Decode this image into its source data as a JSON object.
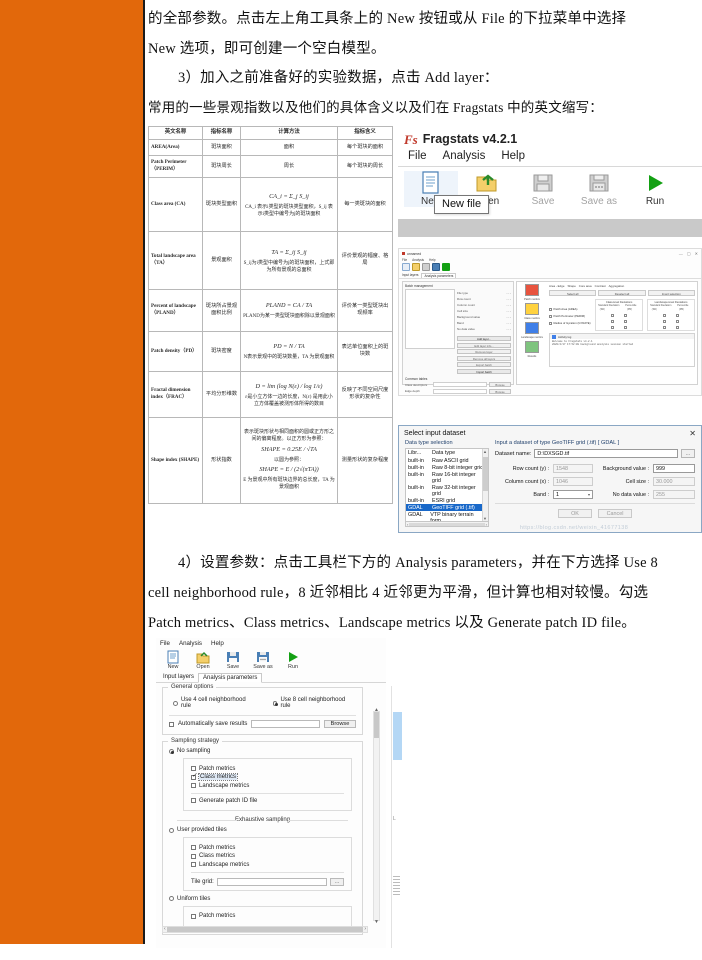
{
  "document": {
    "paragraph_1": "的全部参数。点击左上角工具条上的 New 按钮或从 File 的下拉菜单中选择",
    "paragraph_1b": "New 选项，即可创建一个空白模型。",
    "paragraph_2": "3）加入之前准备好的实验数据，点击 Add layer：",
    "paragraph_3": "常用的一些景观指数以及他们的具体含义以及们在 Fragstats 中的英文缩写：",
    "paragraph_4a": "4）设置参数：点击工具栏下方的 Analysis parameters，并在下方选择 Use 8",
    "paragraph_4b": "cell neighborhood rule，8 近邻相比 4 近邻更为平滑，但计算也相对较慢。勾选",
    "paragraph_4c": "Patch metrics、Class metrics、Landscape metrics 以及 Generate patch ID file。"
  },
  "metric_table": {
    "headers": [
      "英文名称",
      "指标名称",
      "计算方法",
      "指标含义"
    ],
    "rows": [
      {
        "english": "AREA(Area)",
        "chinese": "斑块面积",
        "method_plain": "面积",
        "meaning": "每个斑块的面积"
      },
      {
        "english": "Patch Perimeter（PERIM）",
        "chinese": "斑块周长",
        "method_plain": "周长",
        "meaning": "每个斑块的周长"
      },
      {
        "english": "Class area (CA)",
        "chinese": "斑块类型面积",
        "formula": "CA_i = Σ_j S_ij",
        "method_note": "CA_i 表示i类型的斑块类型面积，S_ij 表示i类型中编号为j的斑块面积",
        "meaning": "每一类斑块的面积"
      },
      {
        "english": "Total landscape area （TA）",
        "chinese": "景观面积",
        "formula": "TA = Σ_ij S_ij",
        "method_note": "S_ij为i类型中编号为j的斑块面积，上式即为所有景观的总面积",
        "meaning": "评价景观的幅度、格局"
      },
      {
        "english": "Percent of landscape（PLAND）",
        "chinese": "斑块所占景观面积比例",
        "formula": "PLAND = CA / TA",
        "method_note": "PLAND为某一类型斑块面积除以景观面积",
        "meaning": "评价某一类型斑块出现频率"
      },
      {
        "english": "Patch density（PD）",
        "chinese": "斑块密度",
        "formula": "PD = N / TA",
        "method_note": "N表示景观中的斑块数量，TA 为景观面积",
        "meaning": "表达单位面积上的斑块数"
      },
      {
        "english": "Fractal dimension index（FRAC）",
        "chinese": "平均分形维数",
        "formula": "D = lim (log N(ε) / log 1/ε)",
        "method_note": "ε是小立方体一边的长度，N(ε) 是用此小立方体覆盖被测形体所得的数目",
        "meaning": "反映了不同空间尺度形状的复杂性"
      },
      {
        "english": "Shape index (SHAPE)",
        "chinese": "形状指数",
        "formula_intro": "表示斑块形状与相同面积的圆或正方形之间的偏离程度。以正方形为参照：",
        "formula_1": "SHAPE = 0.25E / √TA",
        "formula_mid": "以圆为参照：",
        "formula_2": "SHAPE = E / (2√(πTA))",
        "method_note": "E 为景观中所有斑块边界的总长度，TA 为景观面积",
        "meaning": "测量形状的复杂程度"
      }
    ]
  },
  "fragstats_toolbar_shot": {
    "app_title": "Fragstats v4.2.1",
    "logo_text": "Fs",
    "menus": [
      "File",
      "Analysis",
      "Help"
    ],
    "buttons": [
      {
        "label": "New",
        "icon": "new-file-icon",
        "enabled": true
      },
      {
        "label": "Open",
        "icon": "open-folder-icon",
        "enabled": true
      },
      {
        "label": "Save",
        "icon": "save-disk-icon",
        "enabled": false
      },
      {
        "label": "Save as",
        "icon": "save-as-icon",
        "enabled": false
      },
      {
        "label": "Run",
        "icon": "run-play-icon",
        "enabled": true
      }
    ],
    "tooltip": "New file"
  },
  "main_window_shot": {
    "title": "unnamed",
    "menus": [
      "File",
      "Analysis",
      "Help"
    ],
    "toolbar": [
      "New",
      "Open",
      "Save",
      "Save as",
      "Run"
    ],
    "tabs": [
      "Input layers",
      "Analysis parameters"
    ],
    "batch_header": "Batch management",
    "layers_label": "Layers",
    "fields": [
      {
        "label": "File type",
        "value": "- - -"
      },
      {
        "label": "Row count",
        "value": "- - -"
      },
      {
        "label": "Column count",
        "value": "- - -"
      },
      {
        "label": "Cell size",
        "value": "- - -"
      },
      {
        "label": "Background value",
        "value": "- - -"
      },
      {
        "label": "Band",
        "value": "- - -"
      },
      {
        "label": "No data value",
        "value": "- - -"
      }
    ],
    "buttons": [
      "Add layer...",
      "Edit layer info...",
      "Remove layer",
      "Remove all layers",
      "Export batch",
      "Import batch"
    ],
    "common_tables_label": "Common tables",
    "common_rows": [
      {
        "label": "Class descriptors",
        "button": "Browse"
      },
      {
        "label": "Edge depth",
        "button": "Browse"
      }
    ],
    "metric_icons": [
      {
        "label": "Patch metrics",
        "color": "#e8543f"
      },
      {
        "label": "Class metrics",
        "color": "#ffd23f"
      },
      {
        "label": "Landscape metrics",
        "color": "#3f7fe8"
      },
      {
        "label": "Results",
        "color": "#4caf50"
      }
    ],
    "panel_tabs": [
      "Area - Edge",
      "Shape",
      "Core area",
      "Contrast",
      "Aggregation"
    ],
    "select_buttons": [
      "Select all",
      "Deselect all",
      "Invert selection"
    ],
    "group_headers": [
      "Class-level Deviations",
      "Landscape-level Deviations"
    ],
    "sub_headers": [
      "Standard Deviation （SD）",
      "Percentile （PR）"
    ],
    "metric_rows": [
      "Patch Area (AREA)",
      "Patch Perimeter (PERIM)",
      "Radius of Gyration (GYRATE)"
    ],
    "activity_log_label": "Activity log",
    "log_lines": [
      "Welcome to Fragstats v4.2.1",
      "2020/4/17 17:52:08  background analysis session started"
    ]
  },
  "select_dataset_dialog": {
    "title": "Select input dataset",
    "close_icon": "close-x-icon",
    "left_legend": "Data type selection",
    "list_headers": [
      "Libr...",
      "Data type"
    ],
    "list_rows": [
      {
        "lib": "built-in",
        "type": "Raw ASCII grid",
        "selected": false
      },
      {
        "lib": "built-in",
        "type": "Raw 8-bit integer grid",
        "selected": false
      },
      {
        "lib": "built-in",
        "type": "Raw 16-bit integer grid",
        "selected": false
      },
      {
        "lib": "built-in",
        "type": "Raw 32-bit integer grid",
        "selected": false
      },
      {
        "lib": "built-in",
        "type": "ESRI grid",
        "selected": false
      },
      {
        "lib": "GDAL",
        "type": "GeoTIFF grid (.tif)",
        "selected": true
      },
      {
        "lib": "GDAL",
        "type": "VTP binary terrain form...",
        "selected": false
      }
    ],
    "right_legend": "Input a dataset of type GeoTIFF grid (.tif) [ GDAL ]",
    "dataset_name_label": "Dataset name:",
    "dataset_name_value": "D:\\DXSGD.tif",
    "browse_icon": "ellipsis-button",
    "fields": [
      {
        "label": "Row count (y) :",
        "value": "1548",
        "disabled": true
      },
      {
        "label": "Background value :",
        "value": "999",
        "disabled": false
      },
      {
        "label": "Column count (x) :",
        "value": "1046",
        "disabled": true
      },
      {
        "label": "Cell size :",
        "value": "30.000",
        "disabled": true
      },
      {
        "label": "Band :",
        "value": "1",
        "disabled": false,
        "type": "select"
      },
      {
        "label": "No data value :",
        "value": "255",
        "disabled": true
      }
    ],
    "ok_label": "OK",
    "cancel_label": "Cancel",
    "watermark": "https://blog.csdn.net/weixin_41677138"
  },
  "analysis_params_shot": {
    "menus": [
      "File",
      "Analysis",
      "Help"
    ],
    "toolbar": [
      "New",
      "Open",
      "Save",
      "Save as",
      "Run"
    ],
    "tabs": [
      {
        "label": "Input layers",
        "active": false
      },
      {
        "label": "Analysis parameters",
        "active": true
      }
    ],
    "general_options_legend": "General options",
    "neighborhood_rules": [
      {
        "label": "Use 4 cell neighborhood rule",
        "selected": false
      },
      {
        "label": "Use 8 cell neighborhood rule",
        "selected": true
      }
    ],
    "auto_save_label": "Automatically save results",
    "auto_save_checked": false,
    "auto_save_value": "",
    "browse_label": "Browse",
    "sampling_legend": "Sampling strategy",
    "no_sampling": {
      "label": "No sampling",
      "selected": true,
      "options": [
        {
          "label": "Patch metrics",
          "checked": false
        },
        {
          "label": "Class metrics",
          "checked": true,
          "highlighted": true
        },
        {
          "label": "Landscape metrics",
          "checked": false
        }
      ],
      "extra": {
        "label": "Generate patch ID file",
        "checked": false
      }
    },
    "exhaustive_label": "Exhaustive sampling",
    "user_tiles": {
      "label": "User provided tiles",
      "selected": false,
      "options": [
        {
          "label": "Patch metrics",
          "checked": false
        },
        {
          "label": "Class metrics",
          "checked": false
        },
        {
          "label": "Landscape metrics",
          "checked": false
        }
      ],
      "tile_grid_label": "Tile grid:",
      "tile_grid_value": ""
    },
    "uniform_tiles": {
      "label": "Uniform tiles",
      "selected": false,
      "options": [
        {
          "label": "Patch metrics",
          "checked": false
        }
      ]
    }
  },
  "colors": {
    "sidebar_orange": "#E2680B",
    "selection_blue": "#1868C9",
    "highlight_blue": "#DFE9F5",
    "accent_green": "#2E9E2E",
    "page_white": "#FFFFFF"
  }
}
